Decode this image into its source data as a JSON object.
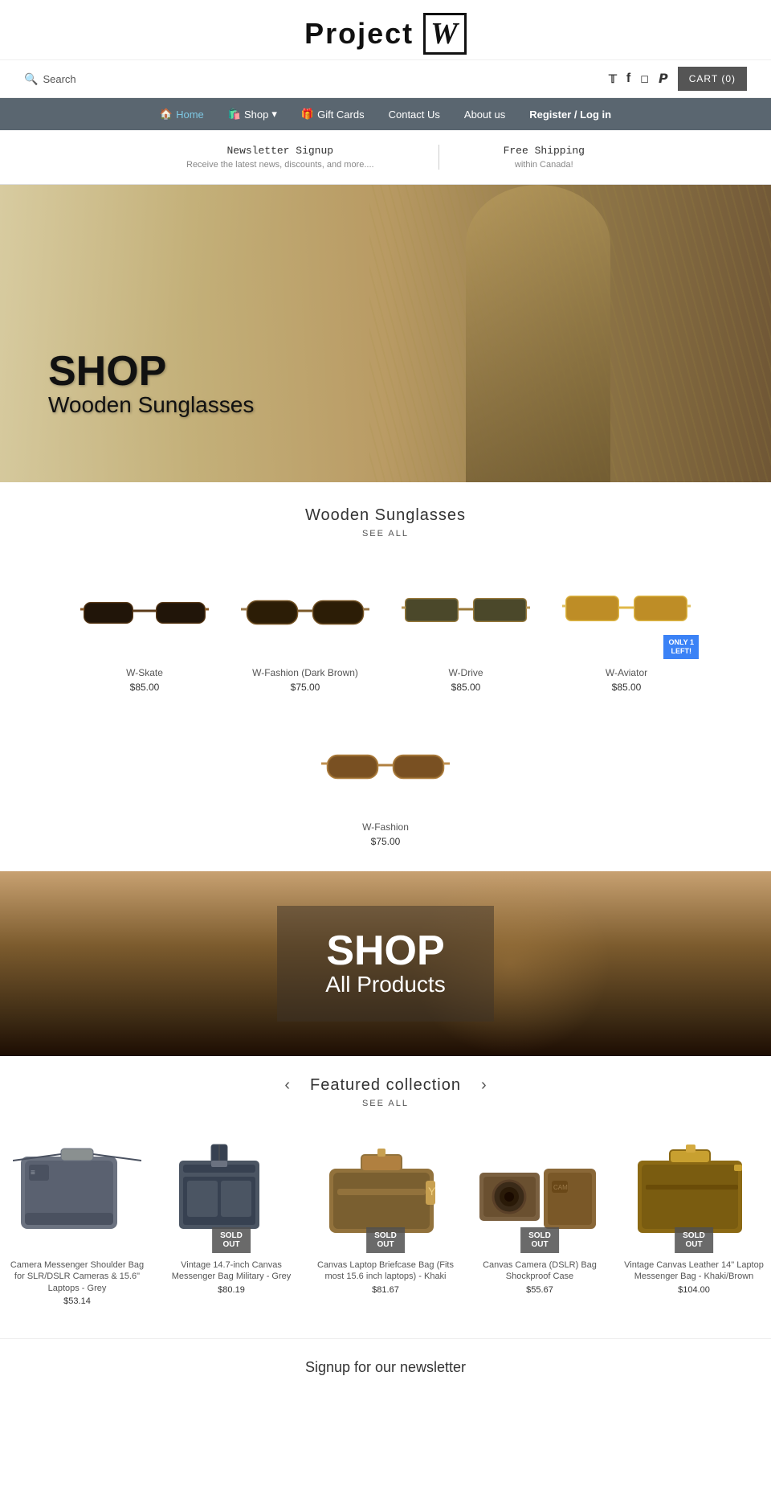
{
  "header": {
    "logo_text": "Project",
    "logo_bold": "W",
    "search_label": "Search",
    "cart_label": "CART",
    "cart_count": "(0)"
  },
  "nav": {
    "items": [
      {
        "label": "Home",
        "active": true,
        "icon": "🏠"
      },
      {
        "label": "Shop",
        "active": false,
        "icon": "🛍️",
        "has_dropdown": true
      },
      {
        "label": "Gift Cards",
        "active": false,
        "icon": "🎁"
      },
      {
        "label": "Contact Us",
        "active": false
      },
      {
        "label": "About us",
        "active": false
      },
      {
        "label": "Register / Log in",
        "active": false
      }
    ]
  },
  "promo": {
    "item1_title": "Newsletter Signup",
    "item1_sub": "Receive the latest news, discounts, and more....",
    "item2_title": "Free Shipping",
    "item2_sub": "within Canada!"
  },
  "hero1": {
    "shop_label": "SHOP",
    "sub_label": "Wooden Sunglasses"
  },
  "sunglasses_section": {
    "title": "Wooden Sunglasses",
    "see_all": "SEE ALL",
    "products": [
      {
        "name": "W-Skate",
        "price": "$85.00",
        "badge": null
      },
      {
        "name": "W-Fashion (Dark Brown)",
        "price": "$75.00",
        "badge": null
      },
      {
        "name": "W-Drive",
        "price": "$85.00",
        "badge": null
      },
      {
        "name": "W-Aviator",
        "price": "$85.00",
        "badge": "ONLY 1\nLEFT!"
      },
      {
        "name": "W-Fashion",
        "price": "$75.00",
        "badge": null
      }
    ]
  },
  "hero2": {
    "shop_label": "SHOP",
    "sub_label": "All Products"
  },
  "featured_section": {
    "title": "Featured collection",
    "see_all": "SEE ALL",
    "products": [
      {
        "name": "Camera Messenger Shoulder Bag for SLR/DSLR Cameras & 15.6\" Laptops - Grey",
        "price": "$53.14",
        "badge": null,
        "color": "#6b7280"
      },
      {
        "name": "Vintage 14.7-inch Canvas Messenger Bag Military - Grey",
        "price": "$80.19",
        "badge": "SOLD OUT",
        "color": "#4b5563"
      },
      {
        "name": "Canvas Laptop Briefcase Bag (Fits most 15.6 inch laptops) - Khaki",
        "price": "$81.67",
        "badge": "SOLD OUT",
        "color": "#92723c"
      },
      {
        "name": "Canvas Camera (DSLR) Bag Shockproof Case",
        "price": "$55.67",
        "badge": "SOLD OUT",
        "color": "#7a6040"
      },
      {
        "name": "Vintage Canvas Leather 14\" Laptop Messenger Bag - Khaki/Brown",
        "price": "$104.00",
        "badge": "SOLD OUT",
        "color": "#8b6914"
      }
    ]
  },
  "newsletter": {
    "title": "Signup for our newsletter"
  },
  "social": {
    "twitter": "𝕏",
    "facebook": "f",
    "instagram": "📷",
    "pinterest": "P"
  }
}
